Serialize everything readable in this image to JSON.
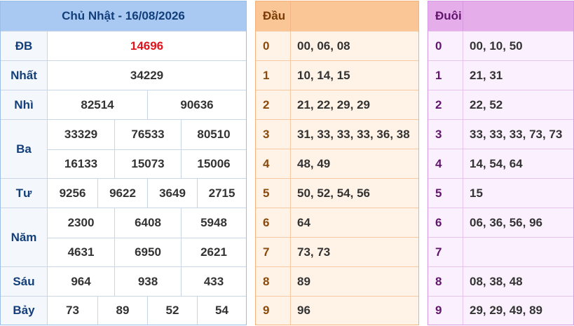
{
  "results": {
    "title": "Chủ Nhật - 16/08/2026",
    "prizes": [
      {
        "label": "ĐB",
        "values": [
          "14696"
        ],
        "highlight": true
      },
      {
        "label": "Nhất",
        "values": [
          "34229"
        ]
      },
      {
        "label": "Nhì",
        "values": [
          "82514",
          "90636"
        ]
      },
      {
        "label": "Ba",
        "rows": [
          [
            "33329",
            "76533",
            "80510"
          ],
          [
            "16133",
            "15073",
            "15006"
          ]
        ]
      },
      {
        "label": "Tư",
        "values": [
          "9256",
          "9622",
          "3649",
          "2715"
        ]
      },
      {
        "label": "Năm",
        "rows": [
          [
            "2300",
            "6408",
            "5948"
          ],
          [
            "4631",
            "6950",
            "2621"
          ]
        ]
      },
      {
        "label": "Sáu",
        "values": [
          "964",
          "938",
          "433"
        ]
      },
      {
        "label": "Bảy",
        "values": [
          "73",
          "89",
          "52",
          "54"
        ]
      }
    ]
  },
  "dau": {
    "header": "Đầu",
    "rows": [
      {
        "digit": "0",
        "values": "00, 06, 08"
      },
      {
        "digit": "1",
        "values": "10, 14, 15"
      },
      {
        "digit": "2",
        "values": "21, 22, 29, 29"
      },
      {
        "digit": "3",
        "values": "31, 33, 33, 33, 36, 38"
      },
      {
        "digit": "4",
        "values": "48, 49"
      },
      {
        "digit": "5",
        "values": "50, 52, 54, 56"
      },
      {
        "digit": "6",
        "values": "64"
      },
      {
        "digit": "7",
        "values": "73, 73"
      },
      {
        "digit": "8",
        "values": "89"
      },
      {
        "digit": "9",
        "values": "96"
      }
    ]
  },
  "duoi": {
    "header": "Đuôi",
    "rows": [
      {
        "digit": "0",
        "values": "00, 10, 50"
      },
      {
        "digit": "1",
        "values": "21, 31"
      },
      {
        "digit": "2",
        "values": "22, 52"
      },
      {
        "digit": "3",
        "values": "33, 33, 33, 73, 73"
      },
      {
        "digit": "4",
        "values": "14, 54, 64"
      },
      {
        "digit": "5",
        "values": "15"
      },
      {
        "digit": "6",
        "values": "06, 36, 56, 96"
      },
      {
        "digit": "7",
        "values": ""
      },
      {
        "digit": "8",
        "values": "08, 38, 48"
      },
      {
        "digit": "9",
        "values": "29, 29, 49, 89"
      }
    ]
  },
  "colors": {
    "highlight": "#e0141d",
    "results_header": "#a9c9f3",
    "dau_header": "#fbc695",
    "duoi_header": "#e5aeea"
  }
}
